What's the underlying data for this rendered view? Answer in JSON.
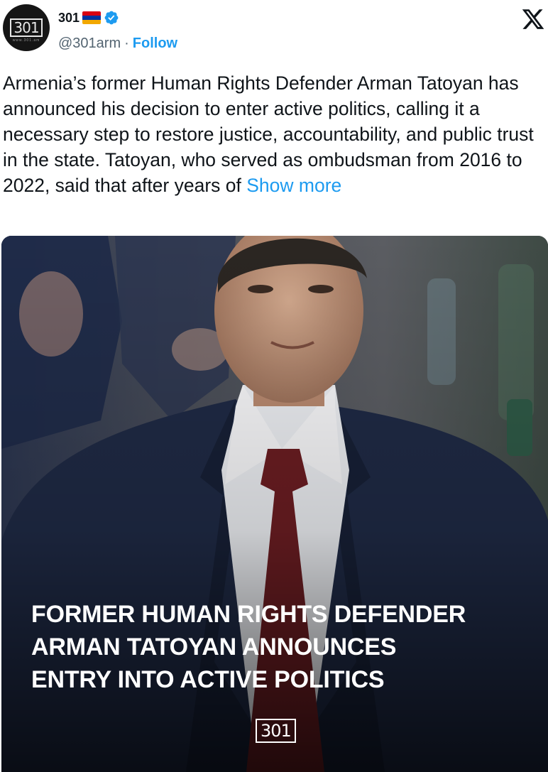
{
  "account": {
    "avatar_text": "301",
    "avatar_sub": "www.301.am",
    "display_name": "301",
    "flag_colors": [
      "#d90012",
      "#0033a0",
      "#f2a800"
    ],
    "verified_icon": "verified-badge-icon",
    "handle": "@301arm",
    "separator": "·",
    "follow_label": "Follow"
  },
  "platform_icon": "x-logo-icon",
  "tweet": {
    "text": "Armenia’s former Human Rights Defender Arman Tatoyan has announced his decision to enter active politics, calling it a necessary step to restore justice, accountability, and public trust in the state. Tatoyan, who served as ombudsman from 2016 to 2022, said that after years of",
    "show_more_label": "Show more"
  },
  "media": {
    "headline_lines": [
      "FORMER HUMAN RIGHTS DEFENDER",
      "ARMAN TATOYAN ANNOUNCES",
      "ENTRY INTO ACTIVE POLITICS"
    ],
    "watermark": "301",
    "colors": {
      "suit": "#1f2a45",
      "shirt": "#f0f0f2",
      "tie": "#6b1d22",
      "skin": "#c49a82",
      "background": "#3a3d45"
    }
  }
}
